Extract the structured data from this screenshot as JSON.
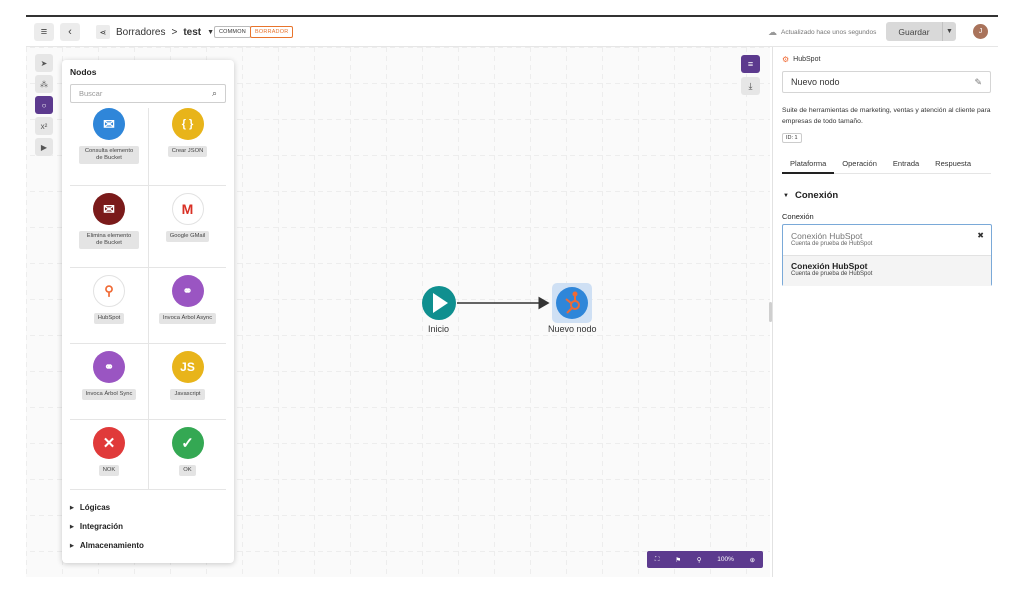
{
  "topbar": {
    "breadcrumb_parent": "Borradores",
    "breadcrumb_sep": ">",
    "breadcrumb_current": "test",
    "tag_common": "COMMON",
    "tag_draft": "BORRADOR",
    "saved_status": "Actualizado hace unos segundos",
    "save_label": "Guardar",
    "avatar_initial": "J"
  },
  "nodes_panel": {
    "title": "Nodos",
    "search_placeholder": "Buscar",
    "items": [
      {
        "label": "Consulta elemento de Bucket",
        "icon": "bucket-search-icon",
        "color": "#2f86d9"
      },
      {
        "label": "Crear JSON",
        "icon": "json-braces-icon",
        "color": "#e8b41a"
      },
      {
        "label": "Elimina elemento de Bucket",
        "icon": "bucket-delete-icon",
        "color": "#7a1a1a"
      },
      {
        "label": "Google GMail",
        "icon": "gmail-icon",
        "color": "#ffffff"
      },
      {
        "label": "HubSpot",
        "icon": "hubspot-icon",
        "color": "#ffffff"
      },
      {
        "label": "Invoca Árbol Async",
        "icon": "tree-async-icon",
        "color": "#9a55c2"
      },
      {
        "label": "Invoca Árbol Sync",
        "icon": "tree-sync-icon",
        "color": "#9a55c2"
      },
      {
        "label": "Javascript",
        "icon": "javascript-icon",
        "color": "#e8b41a"
      },
      {
        "label": "NOK",
        "icon": "close-icon",
        "color": "#e03a3a"
      },
      {
        "label": "OK",
        "icon": "check-icon",
        "color": "#34a853"
      }
    ],
    "categories": [
      "Lógicas",
      "Integración",
      "Almacenamiento"
    ]
  },
  "flow": {
    "start_label": "Inicio",
    "node_label": "Nuevo nodo"
  },
  "zoom": {
    "level": "100%"
  },
  "right_panel": {
    "brand": "HubSpot",
    "node_name": "Nuevo nodo",
    "description": "Suite de herramientas de marketing, ventas y atención al cliente para empresas de todo tamaño.",
    "id_label": "ID: 1",
    "tabs": [
      "Plataforma",
      "Operación",
      "Entrada",
      "Respuesta"
    ],
    "section": "Conexión",
    "field_label": "Conexión",
    "selected_title": "Conexión HubSpot",
    "selected_sub": "Cuenta de prueba de HubSpot",
    "option_title": "Conexión HubSpot",
    "option_sub": "Cuenta de prueba de HubSpot"
  }
}
